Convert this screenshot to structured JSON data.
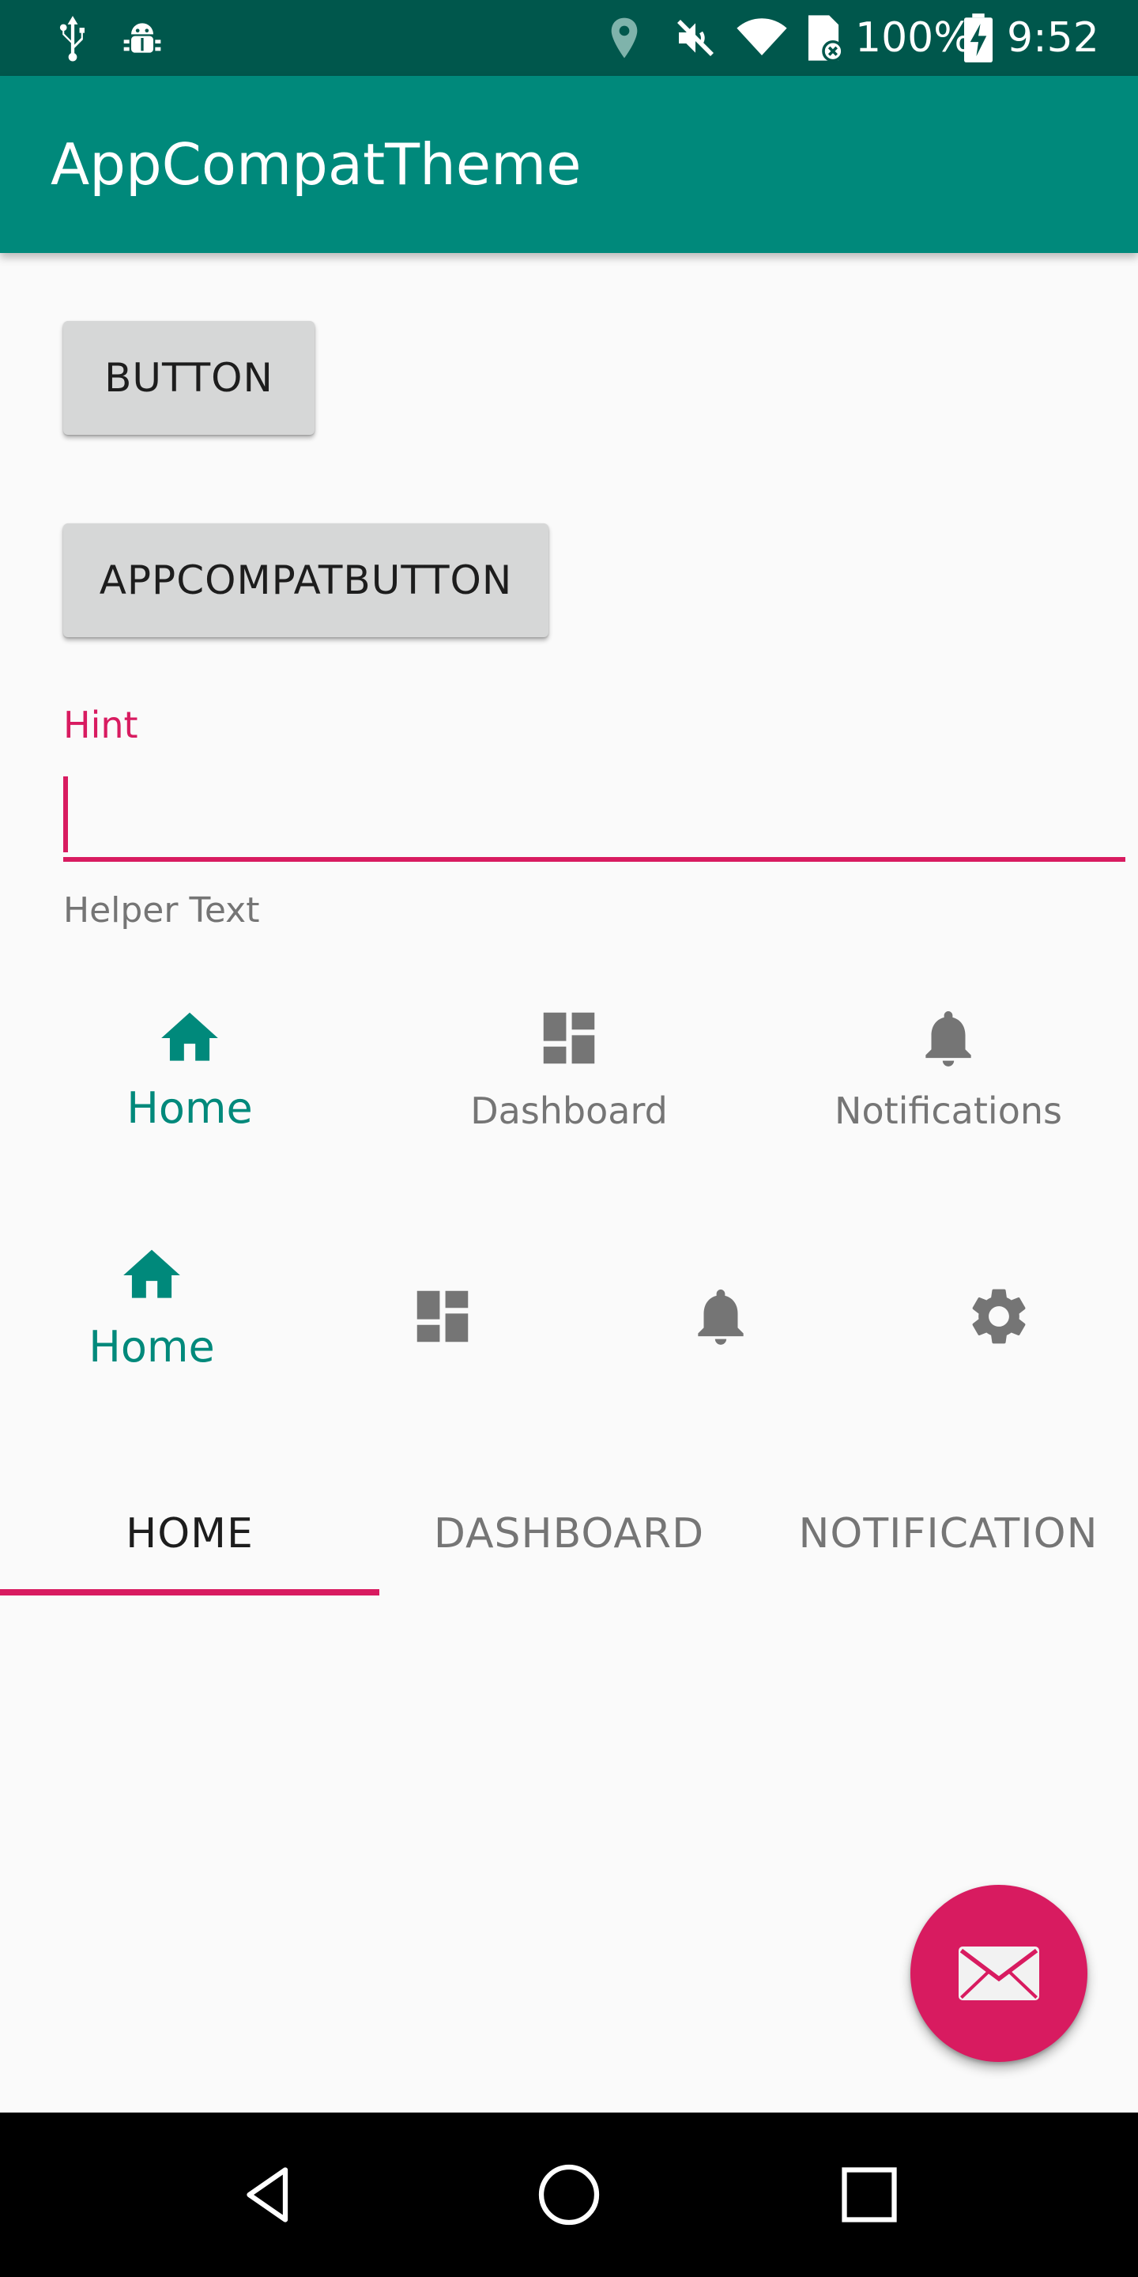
{
  "status_bar": {
    "icons": [
      "usb-icon",
      "android-debug-icon",
      "location-icon",
      "mute-icon",
      "wifi-icon",
      "sim-error-icon",
      "battery-charging-icon"
    ],
    "battery": "100%",
    "time": "9:52"
  },
  "app_bar": {
    "title": "AppCompatTheme"
  },
  "buttons": {
    "button_label": "BUTTON",
    "appcompat_button_label": "APPCOMPATBUTTON"
  },
  "text_field": {
    "hint": "Hint",
    "value": "",
    "helper_text": "Helper Text"
  },
  "bottom_nav_labeled": {
    "items": [
      {
        "label": "Home",
        "icon": "home-icon",
        "active": true
      },
      {
        "label": "Dashboard",
        "icon": "dashboard-icon",
        "active": false
      },
      {
        "label": "Notifications",
        "icon": "bell-icon",
        "active": false
      }
    ]
  },
  "bottom_nav_shifting": {
    "items": [
      {
        "label": "Home",
        "icon": "home-icon",
        "active": true
      },
      {
        "label": "",
        "icon": "dashboard-icon",
        "active": false
      },
      {
        "label": "",
        "icon": "bell-icon",
        "active": false
      },
      {
        "label": "",
        "icon": "gear-icon",
        "active": false
      }
    ]
  },
  "tabs": {
    "items": [
      {
        "label": "HOME",
        "active": true
      },
      {
        "label": "DASHBOARD",
        "active": false
      },
      {
        "label": "NOTIFICATION",
        "active": false
      }
    ]
  },
  "fab": {
    "icon": "email-icon"
  },
  "system_nav": {
    "buttons": [
      "back-icon",
      "home-circle-icon",
      "recents-icon"
    ]
  },
  "colors": {
    "primary": "#00897b",
    "primary_dark": "#00574c",
    "accent": "#d81b60",
    "inactive": "#757575",
    "background": "#fafafa"
  }
}
